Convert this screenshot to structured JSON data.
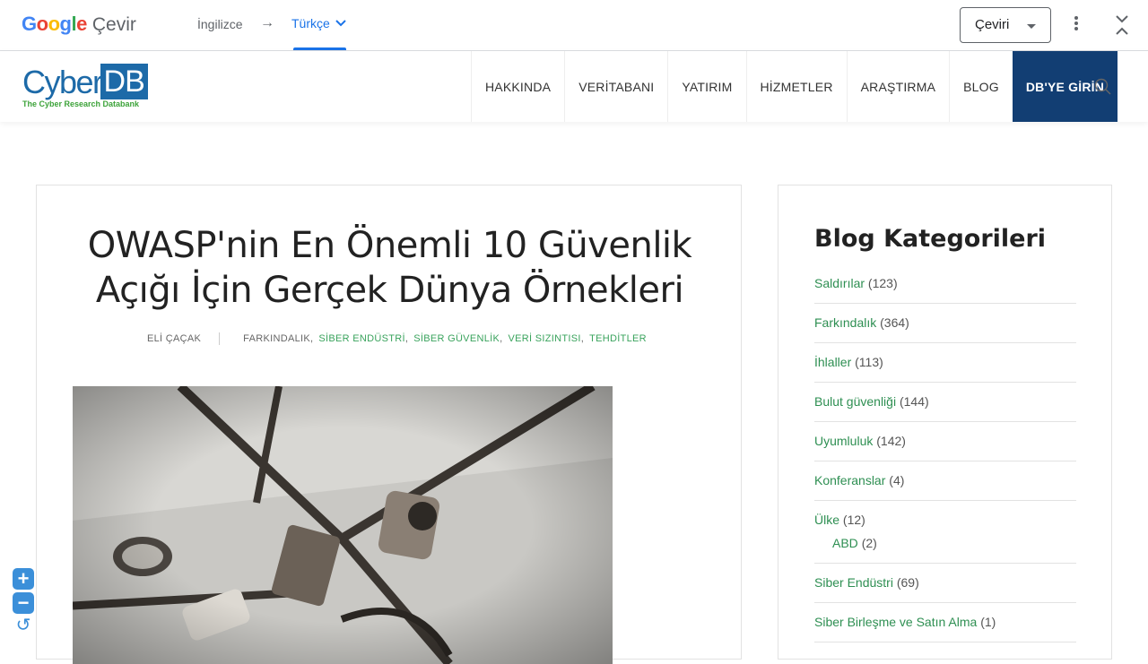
{
  "translate_bar": {
    "logo_word": "Google",
    "product": "Çevir",
    "source_lang": "İngilizce",
    "arrow": "→",
    "target_lang": "Türkçe",
    "mode_select": "Çeviri"
  },
  "site": {
    "logo_main": "Cyber",
    "logo_db": "DB",
    "logo_tagline": "The Cyber Research Databank",
    "nav": [
      "HAKKINDA",
      "VERİTABANI",
      "YATIRIM",
      "HİZMETLER",
      "ARAŞTIRMA",
      "BLOG"
    ],
    "login_label": "DB'YE GİRİN"
  },
  "post": {
    "title_line1": "OWASP'nin En Önemli 10 Güvenlik",
    "title_line2": "Açığı İçin Gerçek Dünya Örnekleri",
    "author": "ELİ ÇAÇAK",
    "categories": [
      "FARKINDALIK",
      "SİBER ENDÜSTRİ",
      "SİBER GÜVENLİK",
      "VERİ SIZINTISI",
      "TEHDİTLER"
    ]
  },
  "sidebar": {
    "title": "Blog Kategorileri",
    "categories": [
      {
        "label": "Saldırılar",
        "count": "(123)"
      },
      {
        "label": "Farkındalık",
        "count": "(364)"
      },
      {
        "label": "İhlaller",
        "count": "(113)"
      },
      {
        "label": "Bulut güvenliği",
        "count": "(144)"
      },
      {
        "label": "Uyumluluk",
        "count": "(142)"
      },
      {
        "label": "Konferanslar",
        "count": "(4)"
      },
      {
        "label": "Ülke",
        "count": "(12)",
        "sub": {
          "label": "ABD",
          "count": "(2)"
        }
      },
      {
        "label": "Siber Endüstri",
        "count": "(69)"
      },
      {
        "label": "Siber Birleşme ve Satın Alma",
        "count": "(1)"
      }
    ]
  },
  "colors": {
    "google_blue": "#1a73e8",
    "brand_blue": "#1d6aa8",
    "login_bg": "#123e73",
    "category_green": "#2e8f52"
  }
}
